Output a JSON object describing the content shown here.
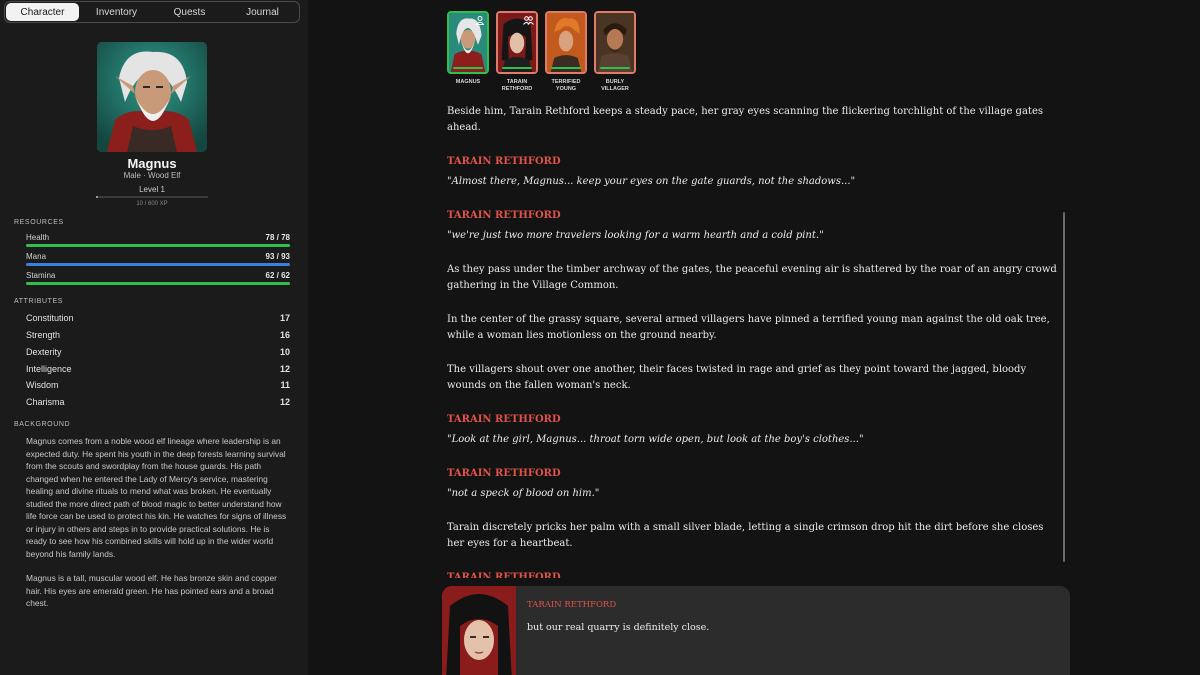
{
  "tabs": [
    {
      "label": "Character",
      "active": true
    },
    {
      "label": "Inventory",
      "active": false
    },
    {
      "label": "Quests",
      "active": false
    },
    {
      "label": "Journal",
      "active": false
    }
  ],
  "character": {
    "name": "Magnus",
    "subtitle": "Male · Wood Elf",
    "level": "Level 1",
    "xp_text": "10 / 600 XP",
    "xp_fraction": 0.017
  },
  "resources": {
    "heading": "RESOURCES",
    "items": [
      {
        "label": "Health",
        "value": "78 / 78",
        "fraction": 1.0,
        "color": "#2fbf4a"
      },
      {
        "label": "Mana",
        "value": "93 / 93",
        "fraction": 1.0,
        "color": "#3b7fe0"
      },
      {
        "label": "Stamina",
        "value": "62 / 62",
        "fraction": 1.0,
        "color": "#2fbf4a"
      }
    ]
  },
  "attributes": {
    "heading": "ATTRIBUTES",
    "items": [
      {
        "label": "Constitution",
        "value": "17"
      },
      {
        "label": "Strength",
        "value": "16"
      },
      {
        "label": "Dexterity",
        "value": "10"
      },
      {
        "label": "Intelligence",
        "value": "12"
      },
      {
        "label": "Wisdom",
        "value": "11"
      },
      {
        "label": "Charisma",
        "value": "12"
      }
    ]
  },
  "background": {
    "heading": "BACKGROUND",
    "paragraphs": [
      "Magnus comes from a noble wood elf lineage where leadership is an expected duty. He spent his youth in the deep forests learning survival from the scouts and swordplay from the house guards. His path changed when he entered the Lady of Mercy's service, mastering healing and divine rituals to mend what was broken. He eventually studied the more direct path of blood magic to better understand how life force can be used to protect his kin. He watches for signs of illness or injury in others and steps in to provide practical solutions. He is ready to see how his combined skills will hold up in the wider world beyond his family lands.",
      "Magnus is a tall, muscular wood elf. He has bronze skin and copper hair. His eyes are emerald green. He has pointed ears and a broad chest."
    ]
  },
  "party": [
    {
      "label_lines": [
        "MAGNUS"
      ],
      "border": "#2fbf4a",
      "hp_color": "#2fbf4a",
      "icon": "person-icon"
    },
    {
      "label_lines": [
        "TARAIN",
        "RETHFORD"
      ],
      "border": "#e07b6a",
      "hp_color": "#2fbf4a",
      "icon": "group-icon"
    },
    {
      "label_lines": [
        "TERRIFIED",
        "YOUNG"
      ],
      "border": "#e07b6a",
      "hp_color": "#2fbf4a",
      "icon": ""
    },
    {
      "label_lines": [
        "BURLY",
        "VILLAGER"
      ],
      "border": "#e07b6a",
      "hp_color": "#2fbf4a",
      "icon": ""
    }
  ],
  "story": [
    {
      "type": "narration",
      "text": "Beside him, Tarain Rethford keeps a steady pace, her gray eyes scanning the flickering torchlight of the village gates ahead."
    },
    {
      "type": "speech",
      "speaker": "TARAIN RETHFORD",
      "text": "\"Almost there, Magnus... keep your eyes on the gate guards, not the shadows...\""
    },
    {
      "type": "speech",
      "speaker": "TARAIN RETHFORD",
      "text": "\"we're just two more travelers looking for a warm hearth and a cold pint.\""
    },
    {
      "type": "narration",
      "text": "As they pass under the timber archway of the gates, the peaceful evening air is shattered by the roar of an angry crowd gathering in the Village Common."
    },
    {
      "type": "narration",
      "text": "In the center of the grassy square, several armed villagers have pinned a terrified young man against the old oak tree, while a woman lies motionless on the ground nearby."
    },
    {
      "type": "narration",
      "text": "The villagers shout over one another, their faces twisted in rage and grief as they point toward the jagged, bloody wounds on the fallen woman's neck."
    },
    {
      "type": "speech",
      "speaker": "TARAIN RETHFORD",
      "text": "\"Look at the girl, Magnus... throat torn wide open, but look at the boy's clothes...\""
    },
    {
      "type": "speech",
      "speaker": "TARAIN RETHFORD",
      "text": "\"not a speck of blood on him.\""
    },
    {
      "type": "narration",
      "text": "Tarain discretely pricks her palm with a small silver blade, letting a single crimson drop hit the dirt before she closes her eyes for a heartbeat."
    },
    {
      "type": "speech",
      "speaker": "TARAIN RETHFORD",
      "text": ""
    }
  ],
  "dialog": {
    "speaker": "TARAIN RETHFORD",
    "text": "but our real quarry is definitely close."
  },
  "colors": {
    "accent_red": "#e0524a",
    "health_green": "#2fbf4a",
    "mana_blue": "#3b7fe0"
  }
}
